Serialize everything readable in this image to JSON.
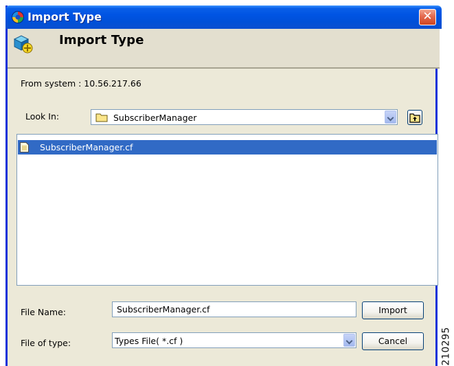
{
  "window": {
    "title": "Import Type",
    "close_glyph": "✕"
  },
  "header": {
    "title": "Import Type",
    "icon": "import-type-icon"
  },
  "from_system": {
    "label": "From system :  10.56.217.66"
  },
  "look_in": {
    "label": "Look In:",
    "value": "SubscriberManager",
    "icon": "folder-icon"
  },
  "file_list": {
    "items": [
      {
        "name": "SubscriberManager.cf",
        "selected": true,
        "icon": "file-icon"
      }
    ]
  },
  "file_name": {
    "label": "File Name:",
    "value": "SubscriberManager.cf"
  },
  "file_type": {
    "label": "File of type:",
    "value": "Types File( *.cf )"
  },
  "buttons": {
    "import": "Import",
    "cancel": "Cancel"
  },
  "side_label": "210295",
  "colors": {
    "titlebar": "#0054e3",
    "window_bg": "#ece9d8",
    "selection": "#316ac5",
    "close": "#e46a4f"
  }
}
